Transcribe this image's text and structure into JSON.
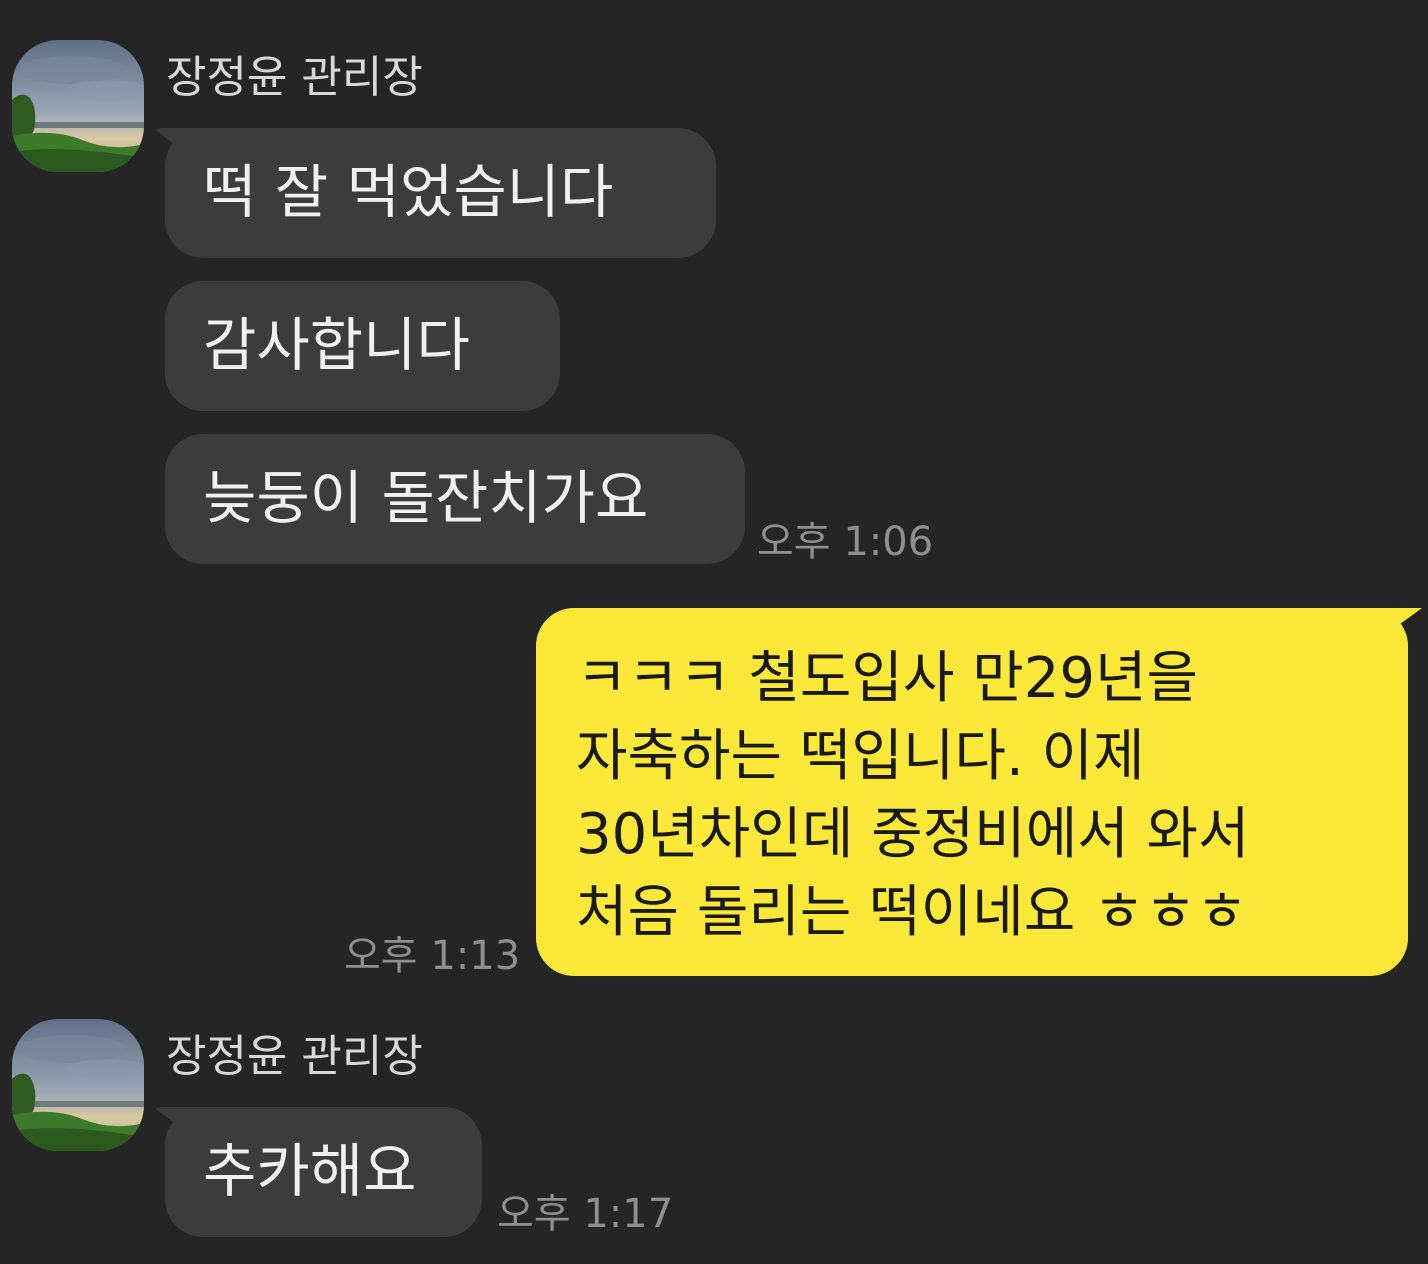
{
  "chat": {
    "groups": [
      {
        "sender": "장정윤 관리장",
        "messages": [
          "떡 잘 먹었습니다",
          "감사합니다",
          "늦둥이 돌잔치가요"
        ],
        "time": "오후 1:06"
      },
      {
        "mine": true,
        "lines": [
          "ㅋㅋㅋ 철도입사 만29년을",
          "자축하는 떡입니다. 이제",
          "30년차인데 중정비에서 와서",
          "처음 돌리는 떡이네요 ㅎㅎㅎ"
        ],
        "time": "오후 1:13"
      },
      {
        "sender": "장정윤 관리장",
        "messages": [
          "추카해요"
        ],
        "time": "오후 1:17"
      }
    ]
  },
  "colors": {
    "background": "#252525",
    "incoming_bubble": "#3c3c3c",
    "outgoing_bubble": "#fce839",
    "timestamp": "#8f8f8f"
  },
  "icons": {
    "avatar": "landscape-photo-avatar"
  }
}
